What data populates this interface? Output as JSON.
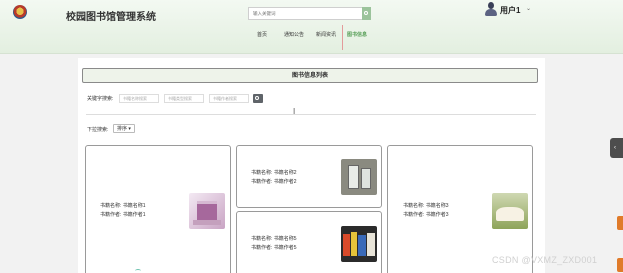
{
  "header": {
    "site_title": "校园图书馆管理系统",
    "search_placeholder": "输入关键词",
    "username": "用户1",
    "nav": [
      "首页",
      "通知公告",
      "新闻资讯",
      "图书信息"
    ]
  },
  "main": {
    "list_title": "图书信息列表",
    "keyword_label": "关键字搜索:",
    "keyword_placeholders": [
      "书籍名称搜索",
      "书籍类型搜索",
      "书籍作者搜索"
    ],
    "sort_label": "下拉搜索:",
    "sort_button": "排序 ▾",
    "books": [
      {
        "name": "书籍名称: 书籍名称1",
        "author": "书籍作者: 书籍作者1"
      },
      {
        "name": "书籍名称: 书籍名称2",
        "author": "书籍作者: 书籍作者2"
      },
      {
        "name": "书籍名称: 书籍名称3",
        "author": "书籍作者: 书籍作者3"
      },
      {
        "name": "书籍名称: 书籍名称5",
        "author": "书籍作者: 书籍作者5"
      }
    ]
  },
  "watermark": "CSDN @VXMZ_ZXD001",
  "colors": {
    "active_nav": "#5aa05a",
    "accent": "#e07b2a"
  }
}
